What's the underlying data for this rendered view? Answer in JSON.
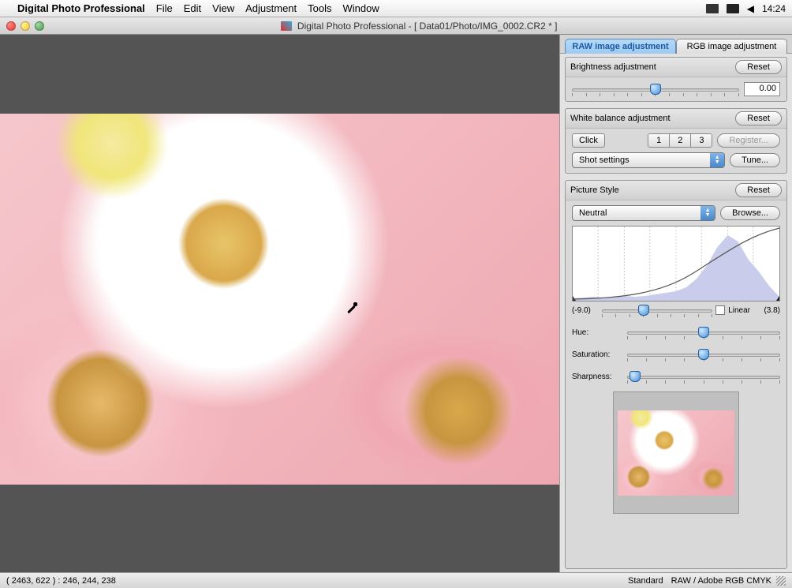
{
  "menubar": {
    "app_name": "Digital Photo Professional",
    "items": [
      "File",
      "Edit",
      "View",
      "Adjustment",
      "Tools",
      "Window"
    ],
    "time": "14:24",
    "speaker": "◀"
  },
  "window": {
    "title": "Digital Photo Professional - [ Data01/Photo/IMG_0002.CR2 * ]"
  },
  "tabs": {
    "raw": "RAW image adjustment",
    "rgb": "RGB image adjustment"
  },
  "brightness": {
    "label": "Brightness adjustment",
    "reset": "Reset",
    "value": "0.00"
  },
  "wb": {
    "label": "White balance adjustment",
    "reset": "Reset",
    "click": "Click",
    "seg1": "1",
    "seg2": "2",
    "seg3": "3",
    "register": "Register...",
    "dropdown": "Shot settings",
    "tune": "Tune..."
  },
  "picture_style": {
    "label": "Picture Style",
    "reset": "Reset",
    "dropdown": "Neutral",
    "browse": "Browse...",
    "range_lo": "(-9.0)",
    "range_hi": "(3.8)",
    "linear": "Linear",
    "hue": "Hue:",
    "saturation": "Saturation:",
    "sharpness": "Sharpness:"
  },
  "statusbar": {
    "coords": "( 2463,  622 ) : 246, 244, 238",
    "standard": "Standard",
    "colorspace": "RAW / Adobe RGB  CMYK"
  },
  "chart_data": {
    "type": "area",
    "title": "Histogram with tone curve",
    "xlabel": "",
    "ylabel": "",
    "x_range": [
      -9.0,
      3.8
    ],
    "curve_slider_pos": 0.38,
    "series": [
      {
        "name": "histogram",
        "x_rel": [
          0.0,
          0.05,
          0.1,
          0.15,
          0.2,
          0.25,
          0.3,
          0.35,
          0.4,
          0.45,
          0.5,
          0.55,
          0.6,
          0.65,
          0.7,
          0.75,
          0.8,
          0.85,
          0.9,
          0.95,
          1.0
        ],
        "y_rel": [
          0.03,
          0.04,
          0.05,
          0.04,
          0.05,
          0.06,
          0.05,
          0.06,
          0.08,
          0.1,
          0.13,
          0.18,
          0.3,
          0.48,
          0.72,
          0.88,
          0.8,
          0.55,
          0.4,
          0.2,
          0.05
        ]
      },
      {
        "name": "tone_curve",
        "x_rel": [
          0.0,
          0.1,
          0.2,
          0.3,
          0.4,
          0.5,
          0.6,
          0.7,
          0.8,
          0.9,
          1.0
        ],
        "y_rel": [
          0.02,
          0.03,
          0.05,
          0.09,
          0.16,
          0.28,
          0.44,
          0.62,
          0.8,
          0.93,
          0.99
        ]
      }
    ]
  }
}
